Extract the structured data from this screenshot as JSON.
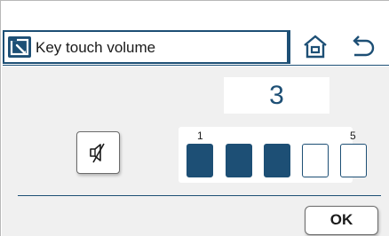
{
  "header": {
    "title": "Key touch volume",
    "title_icon": "edit-window-icon",
    "home_icon": "home-icon",
    "back_icon": "back-arrow-icon"
  },
  "volume": {
    "value": "3",
    "level": 3,
    "max": 5,
    "min_label": "1",
    "max_label": "5",
    "mute_icon": "speaker-mute-icon"
  },
  "footer": {
    "ok_label": "OK"
  },
  "colors": {
    "accent": "#1d4f75",
    "background": "#f0f0f0"
  }
}
